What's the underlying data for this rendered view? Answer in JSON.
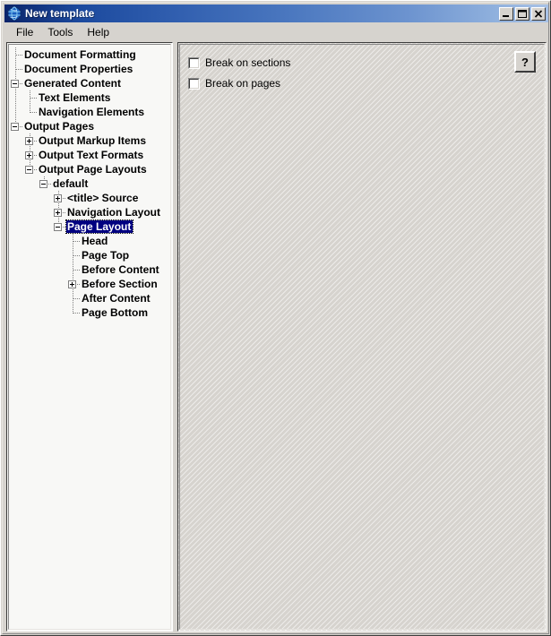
{
  "window": {
    "title": "New template",
    "icon": "globe-icon",
    "controls": {
      "minimize": "minimize-icon",
      "maximize": "maximize-icon",
      "close": "close-icon"
    }
  },
  "menu": {
    "items": [
      {
        "label": "File"
      },
      {
        "label": "Tools"
      },
      {
        "label": "Help"
      }
    ]
  },
  "tree": {
    "selected": "Page Layout",
    "nodes": [
      {
        "label": "Document Formatting",
        "depth": 0,
        "state": "leaf",
        "last": false
      },
      {
        "label": "Document Properties",
        "depth": 0,
        "state": "leaf",
        "last": false
      },
      {
        "label": "Generated Content",
        "depth": 0,
        "state": "expanded",
        "last": false
      },
      {
        "label": "Text Elements",
        "depth": 1,
        "state": "leaf",
        "last": false
      },
      {
        "label": "Navigation Elements",
        "depth": 1,
        "state": "leaf",
        "last": true
      },
      {
        "label": "Output Pages",
        "depth": 0,
        "state": "expanded",
        "last": true
      },
      {
        "label": "Output Markup Items",
        "depth": 1,
        "state": "collapsed",
        "last": false
      },
      {
        "label": "Output Text Formats",
        "depth": 1,
        "state": "collapsed",
        "last": false
      },
      {
        "label": "Output Page Layouts",
        "depth": 1,
        "state": "expanded",
        "last": true
      },
      {
        "label": "default",
        "depth": 2,
        "state": "expanded",
        "last": true
      },
      {
        "label": "<title> Source",
        "depth": 3,
        "state": "collapsed",
        "last": false
      },
      {
        "label": "Navigation Layout",
        "depth": 3,
        "state": "collapsed",
        "last": false
      },
      {
        "label": "Page Layout",
        "depth": 3,
        "state": "expanded",
        "last": true,
        "selected": true
      },
      {
        "label": "Head",
        "depth": 4,
        "state": "leaf",
        "last": false
      },
      {
        "label": "Page Top",
        "depth": 4,
        "state": "leaf",
        "last": false
      },
      {
        "label": "Before Content",
        "depth": 4,
        "state": "leaf",
        "last": false
      },
      {
        "label": "Before Section",
        "depth": 4,
        "state": "collapsed",
        "last": false
      },
      {
        "label": "After Content",
        "depth": 4,
        "state": "leaf",
        "last": false
      },
      {
        "label": "Page Bottom",
        "depth": 4,
        "state": "leaf",
        "last": true
      }
    ]
  },
  "details": {
    "checkboxes": [
      {
        "label": "Break on sections",
        "checked": false
      },
      {
        "label": "Break on pages",
        "checked": false
      }
    ],
    "help_button": {
      "label": "?"
    }
  },
  "colors": {
    "title_bar_start": "#0a246a",
    "title_bar_end": "#a8c2e6",
    "selection": "#000080",
    "face": "#d6d3ce",
    "tree_background": "#f8f8f6"
  }
}
